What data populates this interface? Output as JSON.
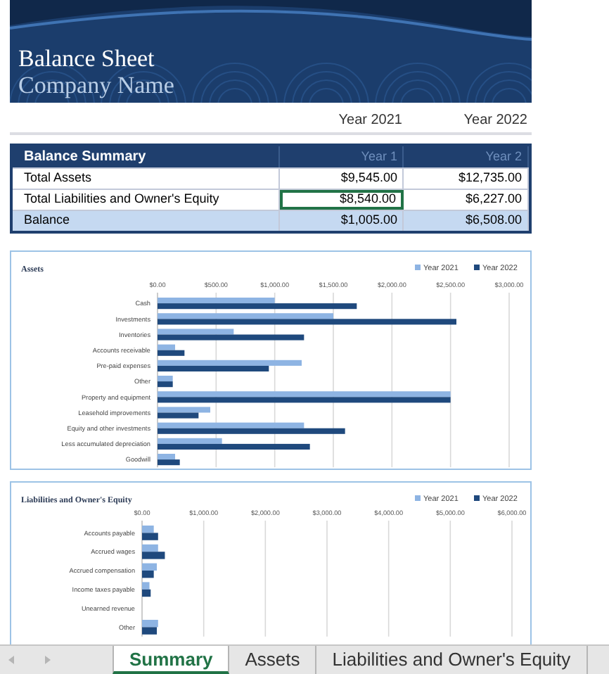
{
  "header": {
    "title": "Balance Sheet",
    "subtitle": "Company Name"
  },
  "year_headers": [
    "Year 2021",
    "Year 2022"
  ],
  "summary_table": {
    "title": "Balance Summary",
    "columns": [
      "Year 1",
      "Year 2"
    ],
    "rows": [
      {
        "label": "Total Assets",
        "highlighted": false,
        "cells": [
          {
            "text": "$9,545.00",
            "selected": false
          },
          {
            "text": "$12,735.00",
            "selected": false
          }
        ]
      },
      {
        "label": "Total Liabilities and Owner's Equity",
        "highlighted": false,
        "cells": [
          {
            "text": "$8,540.00",
            "selected": true
          },
          {
            "text": "$6,227.00",
            "selected": false
          }
        ]
      },
      {
        "label": "Balance",
        "highlighted": true,
        "cells": [
          {
            "text": "$1,005.00",
            "selected": false
          },
          {
            "text": "$6,508.00",
            "selected": false
          }
        ]
      }
    ]
  },
  "assets_chart": {
    "chart_data": {
      "type": "bar",
      "orientation": "horizontal",
      "title": "Assets",
      "categories": [
        "Cash",
        "Investments",
        "Inventories",
        "Accounts receivable",
        "Pre-paid expenses",
        "Other",
        "Property and equipment",
        "Leasehold improvements",
        "Equity and other investments",
        "Less accumulated depreciation",
        "Goodwill"
      ],
      "series": [
        {
          "name": "Year 2021",
          "color": "#8eb4e3",
          "values": [
            1000,
            1500,
            650,
            150,
            1230,
            130,
            2500,
            450,
            1250,
            550,
            150
          ]
        },
        {
          "name": "Year 2022",
          "color": "#1f497d",
          "values": [
            1700,
            2550,
            1250,
            230,
            950,
            130,
            2500,
            350,
            1600,
            1300,
            190
          ]
        }
      ],
      "grid": true,
      "legend": "top-right",
      "xlim": [
        0,
        3000
      ],
      "xticks": [
        {
          "value": 0,
          "label": "$0.00"
        },
        {
          "value": 500,
          "label": "$500.00"
        },
        {
          "value": 1000,
          "label": "$1,000.00"
        },
        {
          "value": 1500,
          "label": "$1,500.00"
        },
        {
          "value": 2000,
          "label": "$2,000.00"
        },
        {
          "value": 2500,
          "label": "$2,500.00"
        },
        {
          "value": 3000,
          "label": "$3,000.00"
        }
      ]
    }
  },
  "liabilities_chart": {
    "chart_data": {
      "type": "bar",
      "orientation": "horizontal",
      "title": "Liabilities and Owner's Equity",
      "categories": [
        "Accounts payable",
        "Accrued wages",
        "Accrued compensation",
        "Income taxes payable",
        "Unearned revenue",
        "Other"
      ],
      "series": [
        {
          "name": "Year 2021",
          "color": "#8eb4e3",
          "values": [
            190,
            260,
            240,
            120,
            0,
            260
          ]
        },
        {
          "name": "Year 2022",
          "color": "#1f497d",
          "values": [
            260,
            370,
            190,
            140,
            0,
            240
          ]
        }
      ],
      "grid": true,
      "legend": "top-right",
      "xlim": [
        0,
        6000
      ],
      "xticks": [
        {
          "value": 0,
          "label": "$0.00"
        },
        {
          "value": 1000,
          "label": "$1,000.00"
        },
        {
          "value": 2000,
          "label": "$2,000.00"
        },
        {
          "value": 3000,
          "label": "$3,000.00"
        },
        {
          "value": 4000,
          "label": "$4,000.00"
        },
        {
          "value": 5000,
          "label": "$5,000.00"
        },
        {
          "value": 6000,
          "label": "$6,000.00"
        }
      ]
    }
  },
  "sheet_tabs": [
    {
      "label": "Summary",
      "selected": true
    },
    {
      "label": "Assets",
      "selected": false
    },
    {
      "label": "Liabilities and Owner's Equity",
      "selected": false
    }
  ]
}
